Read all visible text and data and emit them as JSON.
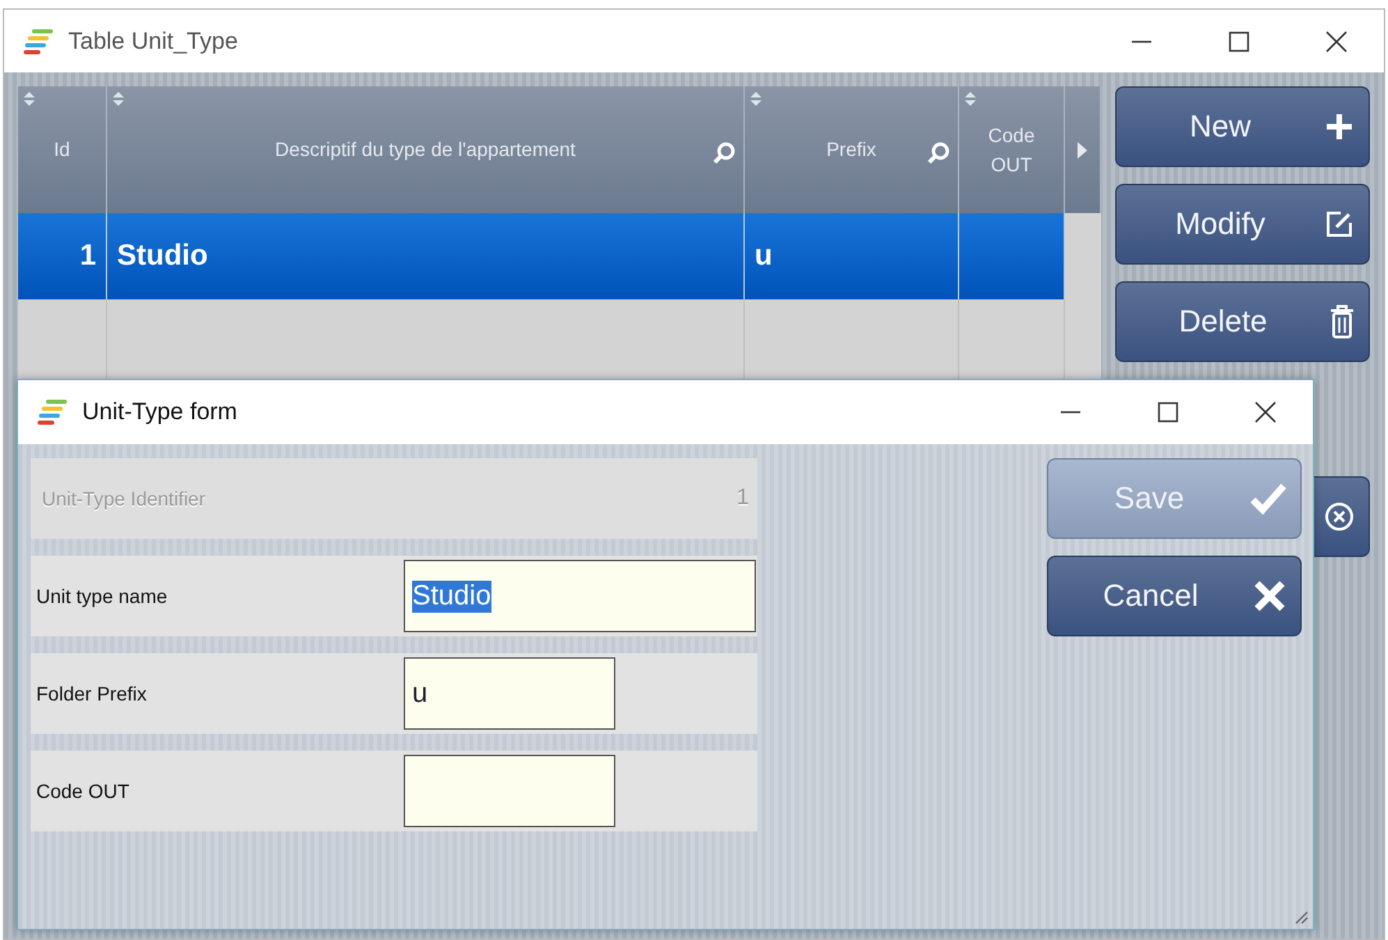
{
  "window": {
    "title": "Table Unit_Type"
  },
  "table": {
    "columns": [
      {
        "label": "Id",
        "searchable": false
      },
      {
        "label": "Descriptif du type de l'appartement",
        "searchable": true
      },
      {
        "label": "Prefix",
        "searchable": true
      },
      {
        "label": "Code OUT",
        "searchable": false
      }
    ],
    "rows": [
      {
        "cells": [
          "1",
          "Studio",
          "u"
        ],
        "selected": true
      }
    ]
  },
  "buttons": [
    {
      "label": "New",
      "kind": "plus"
    },
    {
      "label": "Modify",
      "kind": "edit"
    },
    {
      "label": "Delete",
      "kind": "trash"
    },
    {
      "kind": "close"
    }
  ],
  "dialog": {
    "title": "Unit-Type form",
    "fields": [
      {
        "label": "Unit-Type Identifier",
        "value": "1",
        "kind": "readonly"
      },
      {
        "label": "Unit type name",
        "value": "Studio",
        "kind": "wide",
        "text_selected": true
      },
      {
        "label": "Folder Prefix",
        "value": "u",
        "kind": "narrow"
      },
      {
        "label": "Code OUT",
        "kind": "narrow"
      }
    ],
    "buttons": [
      {
        "label": "Save",
        "kind": "check",
        "disabled": true
      },
      {
        "label": "Cancel",
        "kind": "cross",
        "disabled": false
      }
    ]
  }
}
